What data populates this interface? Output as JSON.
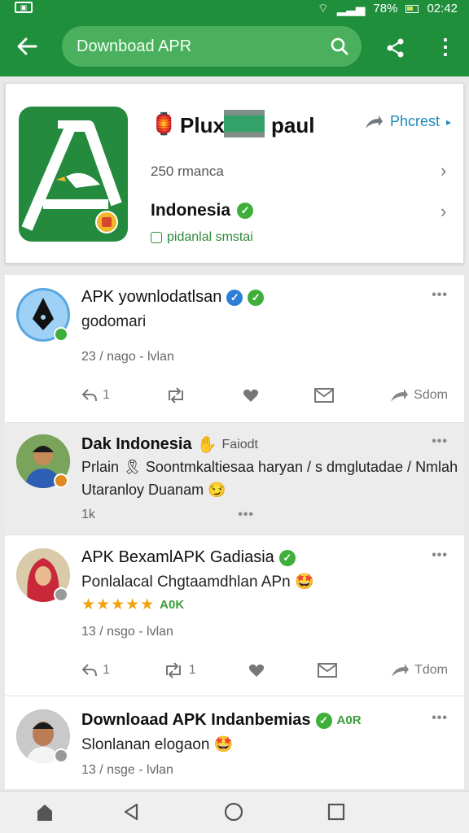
{
  "status_bar": {
    "battery_percent": "78%",
    "time": "02:42"
  },
  "app_bar": {
    "search_text": "Downboad APR"
  },
  "app_card": {
    "name_part_a": "Plux",
    "name_part_b": "paul",
    "action_label": "Phcrest",
    "downloads": "250 rmanca",
    "country": "Indonesia",
    "subtitle": "pidanlal smstai"
  },
  "feed": [
    {
      "name": "APK yownlodatlsan",
      "body_lines": [
        "godomari"
      ],
      "meta": "23 / nago - lvlan",
      "actions": {
        "reply_count": "1",
        "retweet_count": "",
        "share_label": "Sdom"
      }
    },
    {
      "name": "Dak Indonesia",
      "name_extra": "Faiodt",
      "body_lines": [
        "Prlain 🎗 Soontmkaltiesaa haryan / s dmglutadae / Nmlah",
        "Utaranloy Duanam 😏"
      ],
      "meta": "1k"
    },
    {
      "name": "APK BexamlAPK Gadiasia",
      "body_lines": [
        "Ponlalacal Chgtaamdhlan APn 🤩"
      ],
      "stars": "★★★★★",
      "rating_label": "A0K",
      "meta": "13 / nsgo - lvlan",
      "actions": {
        "reply_count": "1",
        "retweet_count": "1",
        "share_label": "Tdom"
      }
    },
    {
      "name": "Downloaad APK Indanbemias",
      "name_extra": "A0R",
      "body_lines": [
        "Slonlanan elogaon 🤩"
      ],
      "meta": "13 / nsge - lvlan"
    }
  ],
  "colors": {
    "brand_green": "#1f8f3c",
    "search_green": "#4ab05d",
    "verified_green": "#3fae3a",
    "verified_blue": "#2b7fd6",
    "link_blue": "#1a88b8",
    "star_orange": "#f2a20f"
  },
  "icons": {
    "back": "arrow-left-icon",
    "search": "search-icon",
    "share": "share-icon",
    "more": "more-vertical-icon",
    "home": "home-icon",
    "back_nav": "triangle-back-icon",
    "circle": "circle-home-icon",
    "square": "square-recents-icon"
  }
}
